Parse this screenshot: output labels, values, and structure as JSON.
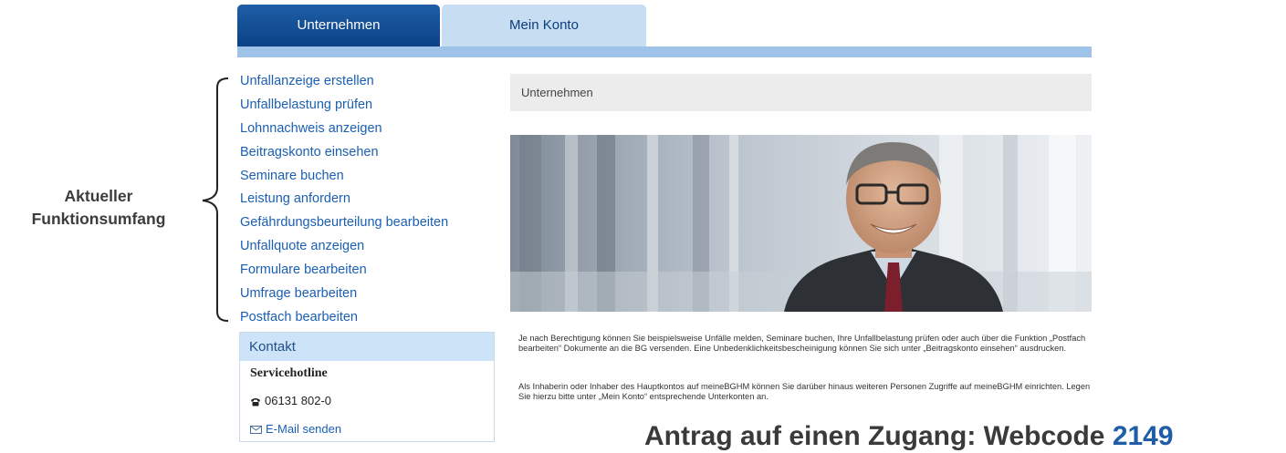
{
  "tabs": [
    {
      "label": "Unternehmen",
      "active": true
    },
    {
      "label": "Mein Konto",
      "active": false
    }
  ],
  "nav": {
    "items": [
      "Unfallanzeige erstellen",
      "Unfallbelastung prüfen",
      "Lohnnachweis anzeigen",
      "Beitragskonto einsehen",
      "Seminare buchen",
      "Leistung anfordern",
      "Gefährdungsbeurteilung bearbeiten",
      "Unfallquote anzeigen",
      "Formulare bearbeiten",
      "Umfrage bearbeiten",
      "Postfach bearbeiten"
    ]
  },
  "annotation": {
    "line1": "Aktueller",
    "line2": "Funktionsumfang"
  },
  "contact": {
    "heading": "Kontakt",
    "title": "Servicehotline",
    "phone": "06131 802-0",
    "email_label": "E-Mail senden"
  },
  "main": {
    "section_title": "Unternehmen",
    "paragraph1": "Je nach Berechtigung können Sie beispielsweise Unfälle melden, Seminare buchen, Ihre Unfallbelastung prüfen oder auch über die Funktion „Postfach bearbeiten“ Dokumente an die BG versenden. Eine Unbedenklichkeitsbescheinigung können Sie sich unter „Beitragskonto einsehen“ ausdrucken.",
    "paragraph2": "Als Inhaberin oder Inhaber des Hauptkontos auf meineBGHM können Sie darüber hinaus weiteren Personen Zugriffe auf meineBGHM einrichten. Legen Sie hierzu bitte unter „Mein Konto“ entsprechende Unterkonten an."
  },
  "footer": {
    "text": "Antrag auf einen Zugang: Webcode",
    "code": "2149"
  },
  "colors": {
    "brand_blue": "#0b4286",
    "link_blue": "#1a5fb4",
    "light_blue": "#c6ddf2"
  },
  "icons": {
    "phone": "phone-icon",
    "mail": "mail-icon",
    "bracket": "curly-bracket"
  }
}
